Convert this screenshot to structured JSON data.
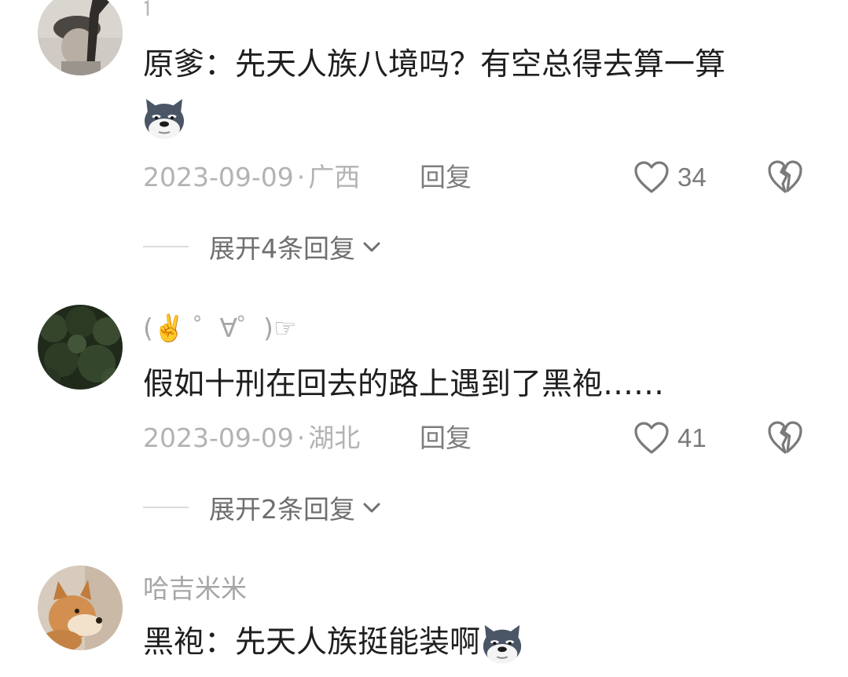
{
  "comments": [
    {
      "username": "",
      "content": "原爹：先天人族八境吗？有空总得去算一算",
      "date": "2023-09-09",
      "location": "广西",
      "reply_label": "回复",
      "likes": "34",
      "expand_label": "展开4条回复",
      "emoji": "doge-wolf-icon"
    },
    {
      "username": "(✌️ ゜∀゜)☞",
      "content": "假如十刑在回去的路上遇到了黑袍……",
      "date": "2023-09-09",
      "location": "湖北",
      "reply_label": "回复",
      "likes": "41",
      "expand_label": "展开2条回复"
    },
    {
      "username": "哈吉米米",
      "content": "黑袍：先天人族挺能装啊",
      "emoji": "doge-wolf-icon"
    }
  ],
  "meta_separator": "·",
  "colors": {
    "text_primary": "#1f1f1f",
    "text_muted": "#a6a6a6",
    "icon": "#7a7a7a"
  }
}
